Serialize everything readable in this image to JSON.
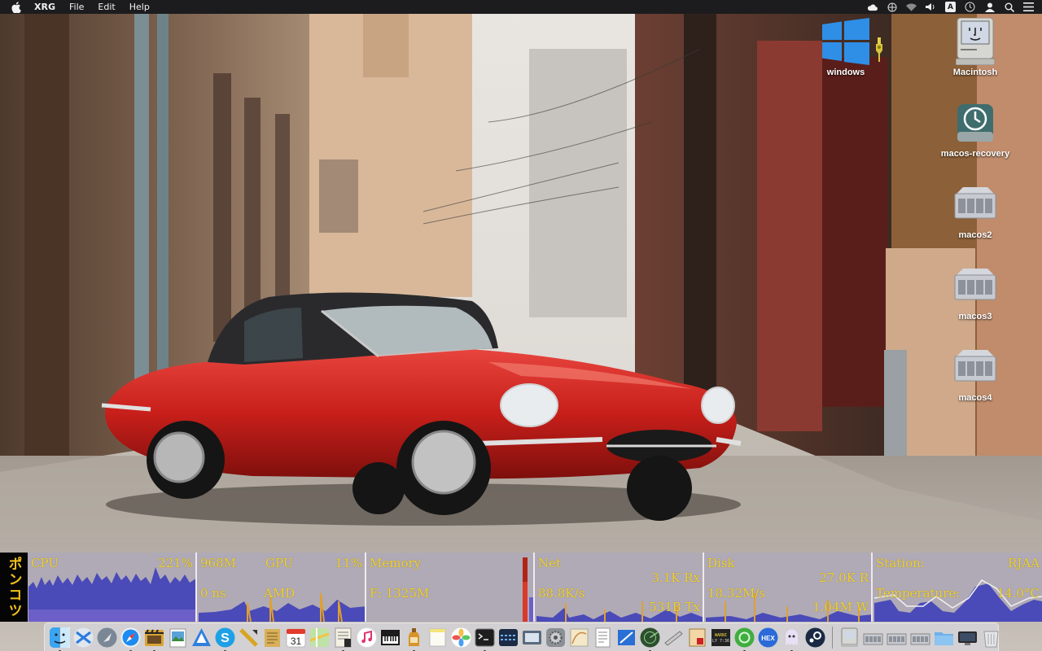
{
  "menubar": {
    "app_name": "XRG",
    "menus": [
      "File",
      "Edit",
      "Help"
    ],
    "status_icons": [
      "icloud-icon",
      "network-icon",
      "wifi-icon",
      "volume-icon",
      "input-source-icon",
      "time-machine-icon",
      "user-icon",
      "spotlight-icon",
      "notification-center-icon"
    ],
    "input_source": "A"
  },
  "desktop_icons": [
    {
      "name": "windows",
      "kind": "windows-drive-icon"
    },
    {
      "name": "",
      "kind": "usb-key-icon"
    },
    {
      "name": "Macintosh",
      "kind": "classic-mac-drive-icon"
    },
    {
      "name": "macos-recovery",
      "kind": "time-machine-drive-icon"
    },
    {
      "name": "macos2",
      "kind": "server-drive-icon"
    },
    {
      "name": "macos3",
      "kind": "server-drive-icon"
    },
    {
      "name": "macos4",
      "kind": "server-drive-icon"
    }
  ],
  "xrg": {
    "title": "ポンコツ",
    "colors": {
      "background": "#b0aab6",
      "text": "#f0d232",
      "graph_primary": "#4a4ab8",
      "graph_secondary": "#e0a030",
      "title_bg": "#050505"
    },
    "cpu": {
      "label": "CPU",
      "value": "221%"
    },
    "gpu": {
      "vram": "968M",
      "label": "GPU",
      "percent": "11%",
      "latency": "0 ns",
      "vendor": "AMD"
    },
    "memory": {
      "label": "Memory",
      "free": "F: 1325M"
    },
    "net": {
      "label": "Net",
      "rx": "3.1K Rx",
      "rate": "88.8K/s",
      "tx": "531B Tx"
    },
    "disk": {
      "label": "Disk",
      "read": "27.0K R",
      "rate": "18.32M/s",
      "write": "1.04M W"
    },
    "weather": {
      "station_label": "Station:",
      "station": "RJAA",
      "temp_label": "Temperature:",
      "temp": "14.0°C"
    }
  },
  "dock": {
    "apps": [
      "finder-icon",
      "migration-assistant-icon",
      "launchpad-icon",
      "safari-icon",
      "final-cut-icon",
      "preview-icon",
      "xcode-instruments-icon",
      "skype-icon",
      "xcode-hammer-icon",
      "notes-pad-icon",
      "calendar-icon",
      "maps-icon",
      "script-editor-icon",
      "music-icon",
      "piano-icon",
      "bottle-icon",
      "stickies-icon",
      "photos-icon",
      "terminal-icon",
      "activity-monitor-icon",
      "screenshot-icon",
      "system-preferences-icon",
      "grapher-icon",
      "textedit-icon",
      "xcode-icon",
      "radar-icon",
      "stylus-icon",
      "script-icon",
      "console-icon",
      "globe-green-icon",
      "hex-fiend-icon",
      "ghost-icon",
      "steam-icon"
    ],
    "calendar_day": "31",
    "right_items": [
      "macintosh-hd-icon",
      "server-drive-icon",
      "server-drive-icon",
      "server-drive-icon",
      "folder-icon",
      "display-icon",
      "trash-icon"
    ]
  }
}
